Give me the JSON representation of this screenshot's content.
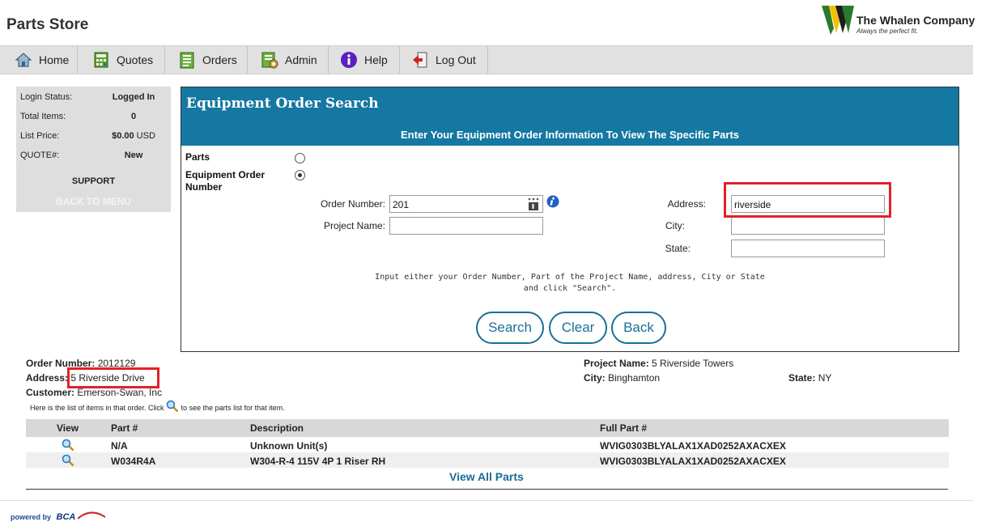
{
  "header": {
    "title": "Parts Store",
    "brand": "The Whalen Company",
    "tagline": "Always the perfect fit."
  },
  "nav": [
    {
      "label": "Home",
      "icon": "home-icon"
    },
    {
      "label": "Quotes",
      "icon": "calculator-icon"
    },
    {
      "label": "Orders",
      "icon": "orders-icon"
    },
    {
      "label": "Admin",
      "icon": "admin-icon"
    },
    {
      "label": "Help",
      "icon": "help-icon"
    },
    {
      "label": "Log Out",
      "icon": "logout-icon"
    }
  ],
  "sidebar": {
    "rows": [
      {
        "label": "Login Status:",
        "value": "Logged In"
      },
      {
        "label": "Total Items:",
        "value": "0"
      },
      {
        "label": "List Price:",
        "value": "$0.00",
        "unit": "USD"
      },
      {
        "label": "QUOTE#:",
        "value": "New"
      }
    ],
    "support": "SUPPORT",
    "back": "BACK TO MENU"
  },
  "search": {
    "title": "Equipment Order Search",
    "subtitle": "Enter Your Equipment Order Information To View The Specific Parts",
    "parts_label": "Parts",
    "eq_label_line1": "Equipment Order",
    "eq_label_line2": "Number",
    "order_number_label": "Order Number:",
    "order_number_value": "201",
    "project_name_label": "Project Name:",
    "project_name_value": "",
    "address_label": "Address:",
    "address_value": "riverside",
    "city_label": "City:",
    "city_value": "",
    "state_label": "State:",
    "state_value": "",
    "hint_line1": "Input either your Order Number, Part of the Project Name, address, City or State",
    "hint_line2": "and click \"Search\".",
    "btn_search": "Search",
    "btn_clear": "Clear",
    "btn_back": "Back"
  },
  "order": {
    "order_number_label": "Order Number:",
    "order_number": "2012129",
    "address_label": "Address:",
    "address": "5 Riverside Drive",
    "customer_label": "Customer:",
    "customer": "Emerson-Swan, Inc",
    "project_label": "Project Name:",
    "project": "5 Riverside Towers",
    "city_label": "City:",
    "city": "Binghamton",
    "state_label": "State:",
    "state": "NY",
    "note_before": "Here is the list of items in that order. Click",
    "note_after": "to see the parts list for that item."
  },
  "table": {
    "headers": [
      "View",
      "Part #",
      "Description",
      "Full Part #"
    ],
    "rows": [
      {
        "part": "N/A",
        "desc": "Unknown Unit(s)",
        "full": "WVIG0303BLYALAX1XAD0252AXACXEX"
      },
      {
        "part": "W034R4A",
        "desc": "W304-R-4 115V 4P 1 Riser RH",
        "full": "WVIG0303BLYALAX1XAD0252AXACXEX"
      }
    ],
    "view_all": "View All Parts"
  },
  "footer": {
    "powered": "powered by",
    "vendor": "BCA"
  },
  "colors": {
    "header_blue": "#1478a2",
    "highlight_red": "#e3202a",
    "link_blue": "#1a6c94"
  }
}
